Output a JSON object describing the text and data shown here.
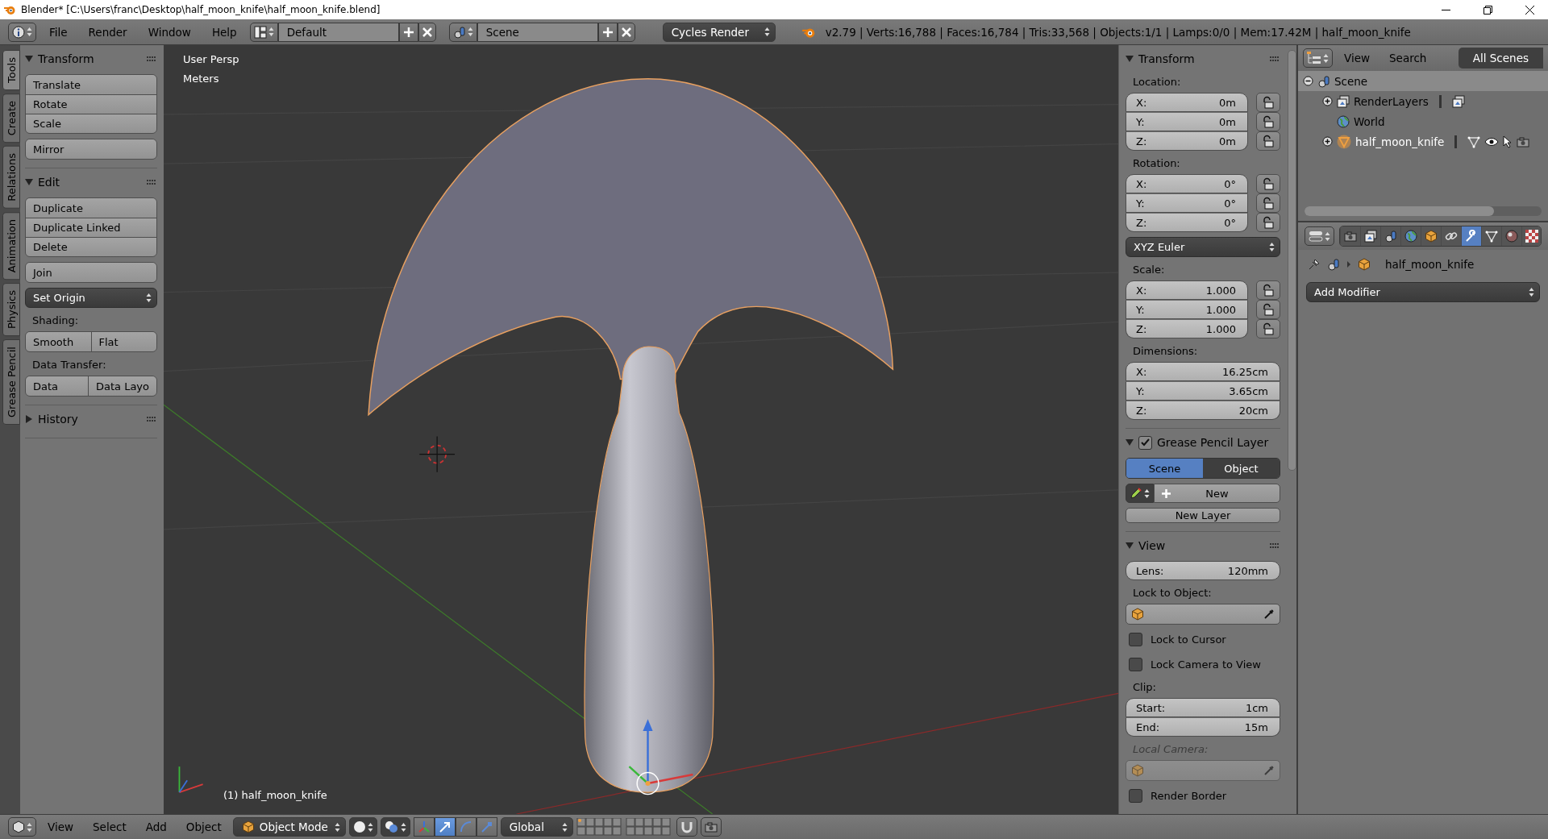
{
  "window": {
    "title": "Blender* [C:\\Users\\franc\\Desktop\\half_moon_knife\\half_moon_knife.blend]"
  },
  "top_header": {
    "menus": [
      "File",
      "Render",
      "Window",
      "Help"
    ],
    "layout": "Default",
    "scene": "Scene",
    "render_engine": "Cycles Render",
    "stats": "v2.79 | Verts:16,788 | Faces:16,784 | Tris:33,568 | Objects:1/1 | Lamps:0/0 | Mem:17.42M | half_moon_knife"
  },
  "tool_tabs": [
    {
      "label": "Tools",
      "selected": true
    },
    {
      "label": "Create",
      "selected": false
    },
    {
      "label": "Relations",
      "selected": false
    },
    {
      "label": "Animation",
      "selected": false
    },
    {
      "label": "Physics",
      "selected": false
    },
    {
      "label": "Grease Pencil",
      "selected": false
    }
  ],
  "tool_panel": {
    "sections": [
      {
        "title": "Transform",
        "expanded": true,
        "rows": [
          {
            "kind": "stack",
            "buttons": [
              "Translate",
              "Rotate",
              "Scale"
            ]
          },
          {
            "kind": "stack",
            "buttons": [
              "Mirror"
            ]
          }
        ]
      },
      {
        "title": "Edit",
        "expanded": true,
        "rows": [
          {
            "kind": "stack",
            "buttons": [
              "Duplicate",
              "Duplicate Linked",
              "Delete"
            ]
          },
          {
            "kind": "stack",
            "buttons": [
              "Join"
            ]
          },
          {
            "kind": "dropdown",
            "label": "Set Origin"
          },
          {
            "kind": "label",
            "text": "Shading:"
          },
          {
            "kind": "pair",
            "buttons": [
              "Smooth",
              "Flat"
            ]
          },
          {
            "kind": "label",
            "text": "Data Transfer:"
          },
          {
            "kind": "pair",
            "buttons": [
              "Data",
              "Data Layo"
            ]
          }
        ]
      },
      {
        "title": "History",
        "expanded": false
      }
    ]
  },
  "viewport": {
    "view_name": "User Persp",
    "units": "Meters",
    "object_label": "(1) half_moon_knife"
  },
  "n_panel": {
    "sections": [
      {
        "title": "Transform",
        "expanded": true,
        "rows": [
          {
            "kind": "label",
            "text": "Location:",
            "disabled": false
          },
          {
            "kind": "vector",
            "fields": [
              {
                "label": "X:",
                "value": "0m",
                "locked": false
              },
              {
                "label": "Y:",
                "value": "0m",
                "locked": false
              },
              {
                "label": "Z:",
                "value": "0m",
                "locked": false
              }
            ]
          },
          {
            "kind": "label",
            "text": "Rotation:",
            "disabled": false
          },
          {
            "kind": "vector",
            "fields": [
              {
                "label": "X:",
                "value": "0°",
                "locked": false
              },
              {
                "label": "Y:",
                "value": "0°",
                "locked": false
              },
              {
                "label": "Z:",
                "value": "0°",
                "locked": false
              }
            ]
          },
          {
            "kind": "dropdown",
            "label": "XYZ Euler"
          },
          {
            "kind": "label",
            "text": "Scale:",
            "disabled": false
          },
          {
            "kind": "vector",
            "fields": [
              {
                "label": "X:",
                "value": "1.000",
                "locked": false
              },
              {
                "label": "Y:",
                "value": "1.000",
                "locked": false
              },
              {
                "label": "Z:",
                "value": "1.000",
                "locked": false
              }
            ]
          },
          {
            "kind": "label",
            "text": "Dimensions:",
            "disabled": false
          },
          {
            "kind": "vector",
            "fields": [
              {
                "label": "X:",
                "value": "16.25cm"
              },
              {
                "label": "Y:",
                "value": "3.65cm"
              },
              {
                "label": "Z:",
                "value": "20cm"
              }
            ]
          }
        ]
      },
      {
        "title": "Grease Pencil Layer",
        "checked": true,
        "expanded": true,
        "rows": [
          {
            "kind": "segmented",
            "options": [
              {
                "label": "Scene",
                "selected": true
              },
              {
                "label": "Object",
                "selected": false
              }
            ]
          },
          {
            "kind": "new",
            "label": "New"
          },
          {
            "kind": "button",
            "label": "New Layer"
          }
        ]
      },
      {
        "title": "View",
        "expanded": true,
        "rows": [
          {
            "kind": "vector",
            "fields": [
              {
                "label": "Lens:",
                "value": "120mm"
              }
            ]
          },
          {
            "kind": "label",
            "text": "Lock to Object:",
            "disabled": false
          },
          {
            "kind": "object_field",
            "disabled": false
          },
          {
            "kind": "checkbox",
            "label": "Lock to Cursor",
            "checked": false
          },
          {
            "kind": "checkbox",
            "label": "Lock Camera to View",
            "checked": false
          },
          {
            "kind": "label",
            "text": "Clip:",
            "disabled": false
          },
          {
            "kind": "vector",
            "fields": [
              {
                "label": "Start:",
                "value": "1cm"
              },
              {
                "label": "End:",
                "value": "15m"
              }
            ]
          },
          {
            "kind": "label",
            "text": "Local Camera:",
            "disabled": true
          },
          {
            "kind": "object_field",
            "disabled": true
          },
          {
            "kind": "checkbox",
            "label": "Render Border",
            "checked": false
          }
        ]
      }
    ]
  },
  "outliner": {
    "menus": [
      "View",
      "Search"
    ],
    "filter": "All Scenes",
    "tree": [
      {
        "name": "Scene",
        "kind": "scene",
        "selected": true,
        "expanded": true,
        "children": [
          {
            "name": "RenderLayers",
            "kind": "render_layers",
            "selected": false,
            "expanded": false
          },
          {
            "name": "World",
            "kind": "world",
            "selected": false
          },
          {
            "name": "half_moon_knife",
            "kind": "mesh_object",
            "selected": false,
            "expanded": false
          }
        ]
      }
    ]
  },
  "properties": {
    "tabs": [
      {
        "kind": "render",
        "selected": false
      },
      {
        "kind": "render_layers",
        "selected": false
      },
      {
        "kind": "scene",
        "selected": false
      },
      {
        "kind": "world",
        "selected": false
      },
      {
        "kind": "object",
        "selected": false
      },
      {
        "kind": "constraints",
        "selected": false
      },
      {
        "kind": "modifiers",
        "selected": true
      },
      {
        "kind": "data",
        "selected": false
      },
      {
        "kind": "material",
        "selected": false
      },
      {
        "kind": "texture",
        "selected": false
      }
    ],
    "object_name": "half_moon_knife",
    "add_modifier": "Add Modifier"
  },
  "bottom_header": {
    "menus": [
      "View",
      "Select",
      "Add",
      "Object"
    ],
    "mode": "Object Mode",
    "manipulators": [
      {
        "kind": "widget",
        "selected": false
      },
      {
        "kind": "translate",
        "selected": true
      },
      {
        "kind": "rotate",
        "selected": false
      },
      {
        "kind": "scale",
        "selected": false
      }
    ],
    "orientation": "Global"
  }
}
